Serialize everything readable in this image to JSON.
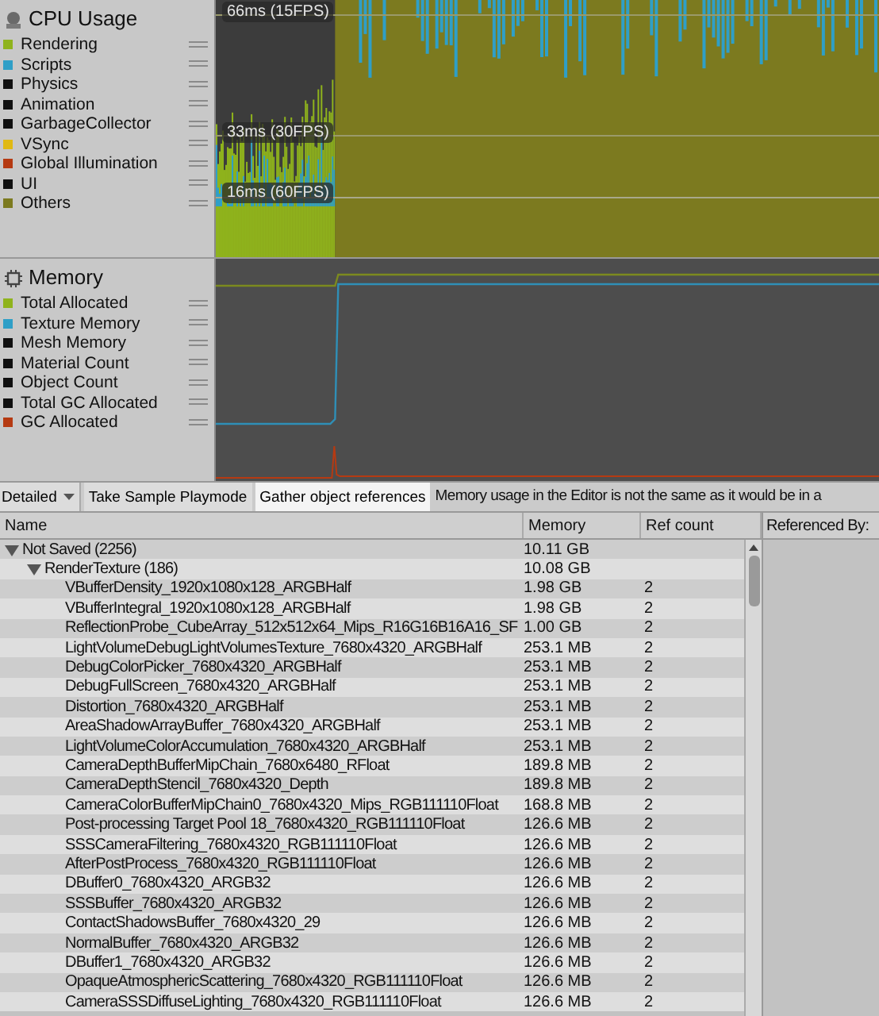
{
  "cpu_module": {
    "title": "CPU Usage",
    "legend": [
      {
        "label": "Rendering",
        "color": "#8fb31c"
      },
      {
        "label": "Scripts",
        "color": "#2f9fc7"
      },
      {
        "label": "Physics",
        "color": "#101010"
      },
      {
        "label": "Animation",
        "color": "#101010"
      },
      {
        "label": "GarbageCollector",
        "color": "#101010"
      },
      {
        "label": "VSync",
        "color": "#e0b912"
      },
      {
        "label": "Global Illumination",
        "color": "#b53a12"
      },
      {
        "label": "UI",
        "color": "#101010"
      },
      {
        "label": "Others",
        "color": "#7c7a1f"
      }
    ],
    "frame_markers": [
      "66ms (15FPS)",
      "33ms (30FPS)",
      "16ms (60FPS)"
    ]
  },
  "memory_module": {
    "title": "Memory",
    "legend": [
      {
        "label": "Total Allocated",
        "color": "#8fb31c"
      },
      {
        "label": "Texture Memory",
        "color": "#2f9fc7"
      },
      {
        "label": "Mesh Memory",
        "color": "#101010"
      },
      {
        "label": "Material Count",
        "color": "#101010"
      },
      {
        "label": "Object Count",
        "color": "#101010"
      },
      {
        "label": "Total GC Allocated",
        "color": "#101010"
      },
      {
        "label": "GC Allocated",
        "color": "#b53a12"
      }
    ]
  },
  "toolbar": {
    "view_dropdown": "Detailed",
    "buttons": [
      {
        "label": "Take Sample Playmode",
        "selected": false
      },
      {
        "label": "Gather object references",
        "selected": true
      }
    ],
    "message": "Memory usage in the Editor is not the same as it would be in a"
  },
  "table": {
    "columns": [
      "Name",
      "Memory",
      "Ref count"
    ],
    "side_panel_title": "Referenced By:",
    "rows": [
      {
        "name": "Not Saved (2256)",
        "memory": "10.11 GB",
        "expanded": true,
        "children": [
          {
            "name": "RenderTexture (186)",
            "memory": "10.08 GB",
            "expanded": true,
            "children": [
              {
                "name": "VBufferDensity_1920x1080x128_ARGBHalf",
                "memory": "1.98 GB",
                "refs": "2"
              },
              {
                "name": "VBufferIntegral_1920x1080x128_ARGBHalf",
                "memory": "1.98 GB",
                "refs": "2"
              },
              {
                "name": "ReflectionProbe_CubeArray_512x512x64_Mips_R16G16B16A16_SF",
                "memory": "1.00 GB",
                "refs": "2"
              },
              {
                "name": "LightVolumeDebugLightVolumesTexture_7680x4320_ARGBHalf",
                "memory": "253.1 MB",
                "refs": "2"
              },
              {
                "name": "DebugColorPicker_7680x4320_ARGBHalf",
                "memory": "253.1 MB",
                "refs": "2"
              },
              {
                "name": "DebugFullScreen_7680x4320_ARGBHalf",
                "memory": "253.1 MB",
                "refs": "2"
              },
              {
                "name": "Distortion_7680x4320_ARGBHalf",
                "memory": "253.1 MB",
                "refs": "2"
              },
              {
                "name": "AreaShadowArrayBuffer_7680x4320_ARGBHalf",
                "memory": "253.1 MB",
                "refs": "2"
              },
              {
                "name": "LightVolumeColorAccumulation_7680x4320_ARGBHalf",
                "memory": "253.1 MB",
                "refs": "2"
              },
              {
                "name": "CameraDepthBufferMipChain_7680x6480_RFloat",
                "memory": "189.8 MB",
                "refs": "2"
              },
              {
                "name": "CameraDepthStencil_7680x4320_Depth",
                "memory": "189.8 MB",
                "refs": "2"
              },
              {
                "name": "CameraColorBufferMipChain0_7680x4320_Mips_RGB111110Float",
                "memory": "168.8 MB",
                "refs": "2"
              },
              {
                "name": "Post-processing Target Pool 18_7680x4320_RGB111110Float",
                "memory": "126.6 MB",
                "refs": "2"
              },
              {
                "name": "SSSCameraFiltering_7680x4320_RGB111110Float",
                "memory": "126.6 MB",
                "refs": "2"
              },
              {
                "name": "AfterPostProcess_7680x4320_RGB111110Float",
                "memory": "126.6 MB",
                "refs": "2"
              },
              {
                "name": "DBuffer0_7680x4320_ARGB32",
                "memory": "126.6 MB",
                "refs": "2"
              },
              {
                "name": "SSSBuffer_7680x4320_ARGB32",
                "memory": "126.6 MB",
                "refs": "2"
              },
              {
                "name": "ContactShadowsBuffer_7680x4320_29",
                "memory": "126.6 MB",
                "refs": "2"
              },
              {
                "name": "NormalBuffer_7680x4320_ARGB32",
                "memory": "126.6 MB",
                "refs": "2"
              },
              {
                "name": "DBuffer1_7680x4320_ARGB32",
                "memory": "126.6 MB",
                "refs": "2"
              },
              {
                "name": "OpaqueAtmosphericScattering_7680x4320_RGB111110Float",
                "memory": "126.6 MB",
                "refs": "2"
              },
              {
                "name": "CameraSSSDiffuseLighting_7680x4320_RGB111110Float",
                "memory": "126.6 MB",
                "refs": "2"
              }
            ]
          }
        ]
      }
    ]
  }
}
